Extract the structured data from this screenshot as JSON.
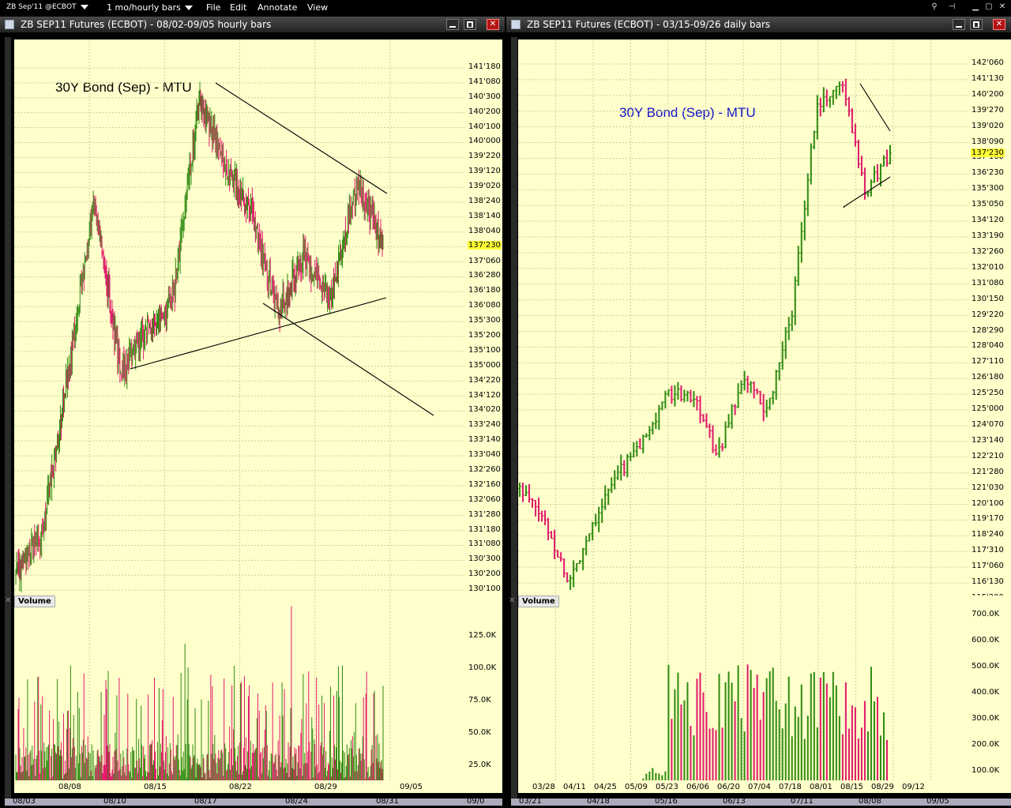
{
  "menubar": {
    "symbol": "ZB Sep'11 @ECBOT",
    "period": "1 mo/hourly bars",
    "menus": [
      "File",
      "Edit",
      "Annotate",
      "View"
    ]
  },
  "colors": {
    "up": "#2f8a10",
    "down": "#e0196a",
    "background": "#ffffcc",
    "lastprice": "#ffff33"
  },
  "left": {
    "title": "ZB SEP11 Futures (ECBOT) - 08/02-09/05  hourly bars",
    "chart_title": "30Y Bond (Sep) - MTU",
    "last_price": "137'230",
    "price_labels": [
      "141'180",
      "141'080",
      "140'300",
      "140'200",
      "140'100",
      "140'000",
      "139'220",
      "139'120",
      "139'020",
      "138'240",
      "138'140",
      "138'040",
      "137'160",
      "137'060",
      "136'280",
      "136'180",
      "136'080",
      "135'300",
      "135'200",
      "135'100",
      "135'000",
      "134'220",
      "134'120",
      "134'020",
      "133'240",
      "133'140",
      "133'040",
      "132'260",
      "132'160",
      "132'060",
      "131'280",
      "131'180",
      "131'080",
      "130'300",
      "130'200",
      "130'100",
      "130'000"
    ],
    "volume_label": "Volume",
    "volume_ticks": [
      "125.0K",
      "100.0K",
      "75.0K",
      "50.0K",
      "25.0K"
    ],
    "date_labels": [
      "08/08",
      "08/15",
      "08/22",
      "08/29",
      "09/05"
    ],
    "bottom_dates": [
      "08/03",
      "08/10",
      "08/17",
      "08/24",
      "08/31",
      "09/0"
    ]
  },
  "right": {
    "title": "ZB SEP11 Futures (ECBOT) - 03/15-09/26  daily bars",
    "chart_title": "30Y Bond (Sep) - MTU",
    "last_price": "137'230",
    "price_labels": [
      "142'060",
      "141'130",
      "140'200",
      "139'270",
      "139'020",
      "138'090",
      "137'160",
      "136'230",
      "135'300",
      "135'050",
      "134'120",
      "133'190",
      "132'260",
      "132'010",
      "131'080",
      "130'150",
      "129'220",
      "128'290",
      "128'040",
      "127'110",
      "126'180",
      "125'250",
      "125'000",
      "124'070",
      "123'140",
      "122'210",
      "121'280",
      "121'030",
      "120'100",
      "119'170",
      "118'240",
      "117'310",
      "117'060",
      "116'130",
      "115'200"
    ],
    "volume_label": "Volume",
    "volume_ticks": [
      "700.0K",
      "600.0K",
      "500.0K",
      "400.0K",
      "300.0K",
      "200.0K",
      "100.0K"
    ],
    "date_labels": [
      "03/28",
      "04/11",
      "04/25",
      "05/09",
      "05/23",
      "06/06",
      "06/20",
      "07/04",
      "07/18",
      "08/01",
      "08/15",
      "08/29",
      "09/12"
    ],
    "bottom_dates": [
      "03/21",
      "04/18",
      "05/16",
      "06/13",
      "07/11",
      "08/08",
      "09/05"
    ]
  },
  "chart_data": [
    {
      "type": "ohlc",
      "title": "30Y Bond (Sep) - MTU",
      "interval": "hourly",
      "x_range": [
        "08/02",
        "09/05"
      ],
      "ylim": [
        "130'000",
        "141'180"
      ],
      "last": "137'230",
      "approx_path": [
        [
          "08/03",
          "130'200"
        ],
        [
          "08/05",
          "131'180"
        ],
        [
          "08/08",
          "135'000"
        ],
        [
          "08/10",
          "138'240"
        ],
        [
          "08/11",
          "135'000"
        ],
        [
          "08/15",
          "135'300"
        ],
        [
          "08/16",
          "136'180"
        ],
        [
          "08/18",
          "140'300"
        ],
        [
          "08/22",
          "139'120"
        ],
        [
          "08/24",
          "138'140"
        ],
        [
          "08/25",
          "136'080"
        ],
        [
          "08/27",
          "137'160"
        ],
        [
          "08/29",
          "136'180"
        ],
        [
          "08/31",
          "139'020"
        ],
        [
          "09/01",
          "137'230"
        ]
      ],
      "trendlines": [
        {
          "from": [
            "08/18",
            "141'080"
          ],
          "to": [
            "09/01",
            "138'140"
          ]
        },
        {
          "from": [
            "08/11",
            "135'000"
          ],
          "to": [
            "09/01",
            "136'180"
          ]
        },
        {
          "from": [
            "08/24",
            "136'180"
          ],
          "to": [
            "09/05",
            "134'020"
          ]
        }
      ],
      "volume_range": [
        "0",
        "125.0K"
      ]
    },
    {
      "type": "ohlc",
      "title": "30Y Bond (Sep) - MTU",
      "interval": "daily",
      "x_range": [
        "03/15",
        "09/26"
      ],
      "ylim": [
        "115'200",
        "142'060"
      ],
      "last": "137'230",
      "approx_path": [
        [
          "03/15",
          "121'030"
        ],
        [
          "03/28",
          "119'170"
        ],
        [
          "04/11",
          "116'130"
        ],
        [
          "04/25",
          "119'170"
        ],
        [
          "05/09",
          "121'280"
        ],
        [
          "05/23",
          "123'140"
        ],
        [
          "06/06",
          "125'250"
        ],
        [
          "06/20",
          "125'250"
        ],
        [
          "07/04",
          "122'210"
        ],
        [
          "07/18",
          "126'180"
        ],
        [
          "07/25",
          "125'000"
        ],
        [
          "08/01",
          "129'220"
        ],
        [
          "08/08",
          "139'270"
        ],
        [
          "08/15",
          "141'130"
        ],
        [
          "08/22",
          "135'300"
        ],
        [
          "08/29",
          "137'230"
        ]
      ],
      "trendlines": [
        {
          "from": [
            "08/08",
            "141'130"
          ],
          "to": [
            "08/29",
            "139'020"
          ]
        },
        {
          "from": [
            "08/05",
            "135'050"
          ],
          "to": [
            "08/29",
            "136'230"
          ]
        }
      ],
      "volume_range": [
        "0",
        "700.0K"
      ]
    }
  ]
}
